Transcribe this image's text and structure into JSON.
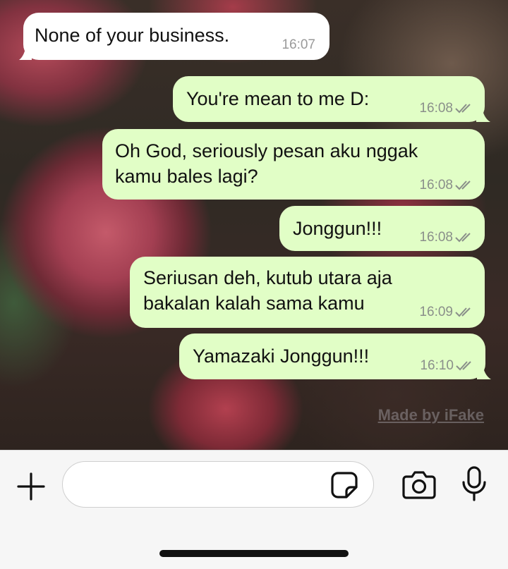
{
  "chat": {
    "messages": [
      {
        "direction": "in",
        "lines": [
          "None of your business."
        ],
        "time": "16:07"
      },
      {
        "direction": "out",
        "lines": [
          "You're mean to me D:"
        ],
        "time": "16:08",
        "status": "read-double-check"
      },
      {
        "direction": "out",
        "lines": [
          "Oh God, seriously pesan aku nggak",
          "kamu bales lagi?"
        ],
        "time": "16:08",
        "status": "read-double-check"
      },
      {
        "direction": "out",
        "lines": [
          "Jonggun!!!"
        ],
        "time": "16:08",
        "status": "read-double-check"
      },
      {
        "direction": "out",
        "lines": [
          "Seriusan deh, kutub utara aja",
          "bakalan kalah sama kamu"
        ],
        "time": "16:09",
        "status": "read-double-check"
      },
      {
        "direction": "out",
        "lines": [
          "Yamazaki Jonggun!!!"
        ],
        "time": "16:10",
        "status": "read-double-check"
      }
    ],
    "watermark": "Made by iFake"
  },
  "composer": {
    "input_value": "",
    "icons": {
      "attach": "plus-icon",
      "sticker": "sticker-icon",
      "camera": "camera-icon",
      "mic": "microphone-icon"
    }
  },
  "colors": {
    "incoming_bubble": "#ffffff",
    "outgoing_bubble": "#e1fec6",
    "meta_text": "#8a8f8a",
    "input_bar": "#f6f6f6"
  }
}
